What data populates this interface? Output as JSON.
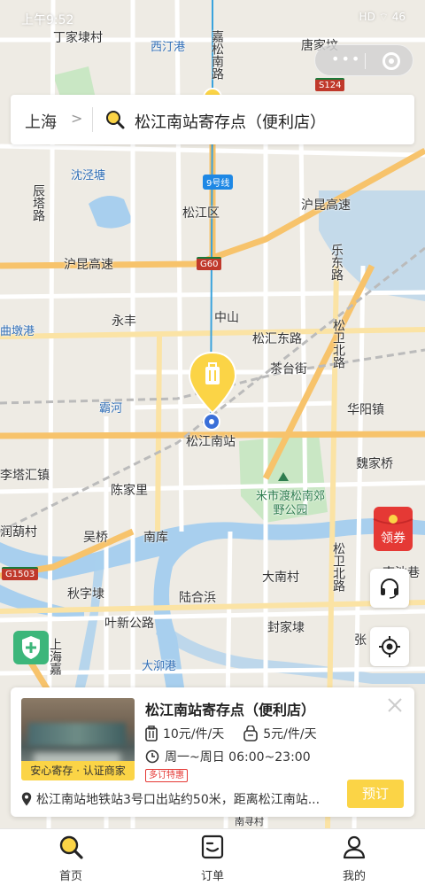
{
  "status_bar": {
    "time": "上午9:52",
    "icons": "HD ⌔ 46"
  },
  "search": {
    "city": "上海",
    "query": "松江南站寄存点（便利店）"
  },
  "map": {
    "labels": {
      "dingjiadai": "丁家埭村",
      "xixi": "西汀港",
      "tangjia": "唐家坟",
      "jiasong": "嘉松南路",
      "shenjing": "沈泾塘",
      "chenta": "辰塔路",
      "songjiang": "松江区",
      "hukun_hwy_e": "沪昆高速",
      "hukun_hwy_w": "沪昆高速",
      "leshan": "乐东路",
      "yongfeng": "永丰",
      "zhongshan": "中山",
      "songjiang_east": "松汇东路",
      "songwei_north": "松卫北路",
      "chatai": "茶台街",
      "qudun": "曲墩港",
      "bahe": "霸河",
      "songjiang_south_station": "松江南站",
      "huayang": "华阳镇",
      "litahui": "李塔汇镇",
      "weijiaqiao": "魏家桥",
      "chenjiali": "陈家里",
      "park": "米市渡松南郊野公园",
      "shuhu": "润葫村",
      "wuqiao": "吴桥",
      "nanku": "南库",
      "songwei_north2": "松卫北路",
      "nanchi": "南池巷",
      "dananchun": "大南村",
      "qiuzidai": "秋字埭",
      "luhebin": "陆合浜",
      "yexin": "叶新公路",
      "fengjiadai": "封家埭",
      "zhang": "张",
      "shangyin": "上海嘉",
      "daxugang": "大泖港",
      "nanxun": "南寻村"
    },
    "road_shields": {
      "s124": "S124",
      "g60": "G60",
      "g1503": "G1503",
      "metro": "9号线"
    },
    "colors": {
      "accent": "#fbd446",
      "water": "#a8cfee",
      "park": "#c9e7c4",
      "highway": "#f7c36b",
      "metro": "#3aa3dd"
    }
  },
  "coupon": {
    "label": "领券"
  },
  "store_card": {
    "title": "松江南站寄存点（便利店）",
    "badge": "安心寄存 · 认证商家",
    "price_large": "10元/件/天",
    "price_small": "5元/件/天",
    "hours": "周一~周日 06:00~23:00",
    "promo": "多订特惠",
    "address": "松江南站地铁站3号口出站约50米，距离松江南站...",
    "book_label": "预订"
  },
  "tabs": [
    {
      "label": "首页",
      "icon": "search-icon"
    },
    {
      "label": "订单",
      "icon": "order-icon"
    },
    {
      "label": "我的",
      "icon": "profile-icon"
    }
  ]
}
